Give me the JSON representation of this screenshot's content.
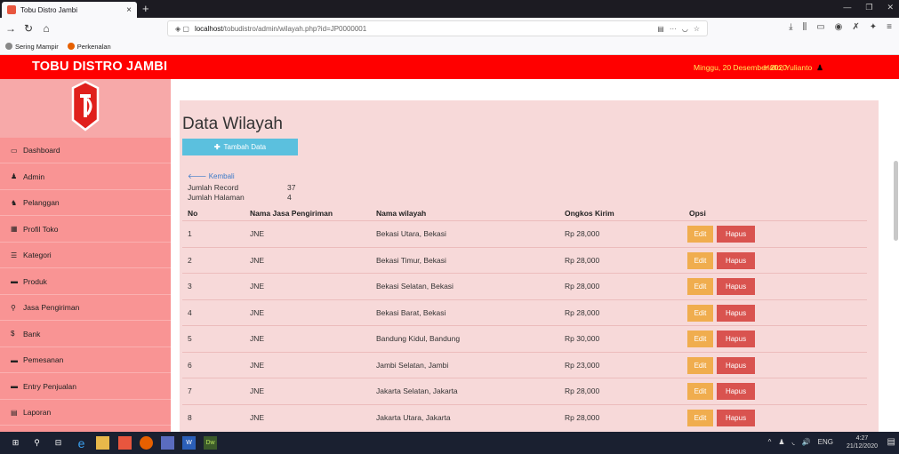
{
  "browser": {
    "tab_title": "Tobu Distro Jambi",
    "url_host": "localhost",
    "url_path": "/tobudistro/admin/wilayah.php?id=JP0000001",
    "bookmarks": [
      "Sering Mampir",
      "Perkenalan"
    ]
  },
  "header": {
    "brand": "TOBU DISTRO JAMBI",
    "date": "Minggu, 20 Desember 2020",
    "greeting": "Hallo, Yulianto"
  },
  "sidebar": {
    "items": [
      {
        "label": "Dashboard",
        "icon": "monitor-icon"
      },
      {
        "label": "Admin",
        "icon": "user-icon"
      },
      {
        "label": "Pelanggan",
        "icon": "users-icon"
      },
      {
        "label": "Profil Toko",
        "icon": "table-icon"
      },
      {
        "label": "Kategori",
        "icon": "list-icon"
      },
      {
        "label": "Produk",
        "icon": "folder-icon"
      },
      {
        "label": "Jasa Pengiriman",
        "icon": "map-marker-icon"
      },
      {
        "label": "Bank",
        "icon": "dollar-icon"
      },
      {
        "label": "Pemesanan",
        "icon": "card-icon"
      },
      {
        "label": "Entry Penjualan",
        "icon": "card-icon"
      },
      {
        "label": "Laporan",
        "icon": "report-icon"
      }
    ]
  },
  "main": {
    "title": "Data Wilayah",
    "add_button": "Tambah Data",
    "back_link": "Kembali",
    "record_label": "Jumlah Record",
    "record_value": "37",
    "page_label": "Jumlah Halaman",
    "page_value": "4",
    "columns": [
      "No",
      "Nama Jasa Pengiriman",
      "Nama wilayah",
      "Ongkos Kirim",
      "Opsi"
    ],
    "edit_label": "Edit",
    "delete_label": "Hapus",
    "rows": [
      {
        "no": "1",
        "jasa": "JNE",
        "wilayah": "Bekasi Utara, Bekasi",
        "ongkos": "Rp 28,000"
      },
      {
        "no": "2",
        "jasa": "JNE",
        "wilayah": "Bekasi Timur, Bekasi",
        "ongkos": "Rp 28,000"
      },
      {
        "no": "3",
        "jasa": "JNE",
        "wilayah": "Bekasi Selatan, Bekasi",
        "ongkos": "Rp 28,000"
      },
      {
        "no": "4",
        "jasa": "JNE",
        "wilayah": "Bekasi Barat, Bekasi",
        "ongkos": "Rp 28,000"
      },
      {
        "no": "5",
        "jasa": "JNE",
        "wilayah": "Bandung Kidul, Bandung",
        "ongkos": "Rp 30,000"
      },
      {
        "no": "6",
        "jasa": "JNE",
        "wilayah": "Jambi Selatan, Jambi",
        "ongkos": "Rp 23,000"
      },
      {
        "no": "7",
        "jasa": "JNE",
        "wilayah": "Jakarta Selatan, Jakarta",
        "ongkos": "Rp 28,000"
      },
      {
        "no": "8",
        "jasa": "JNE",
        "wilayah": "Jakarta Utara, Jakarta",
        "ongkos": "Rp 28,000"
      }
    ]
  },
  "taskbar": {
    "lang": "ENG",
    "time": "4:27",
    "date": "21/12/2020"
  },
  "colors": {
    "header_bg": "#ff0000",
    "sidebar_bg": "#f99494",
    "panel_bg": "#f7d9d9",
    "add_button": "#5bc0de",
    "edit_button": "#f0ad4e",
    "delete_button": "#d9534f",
    "header_text": "#ffe85a"
  }
}
